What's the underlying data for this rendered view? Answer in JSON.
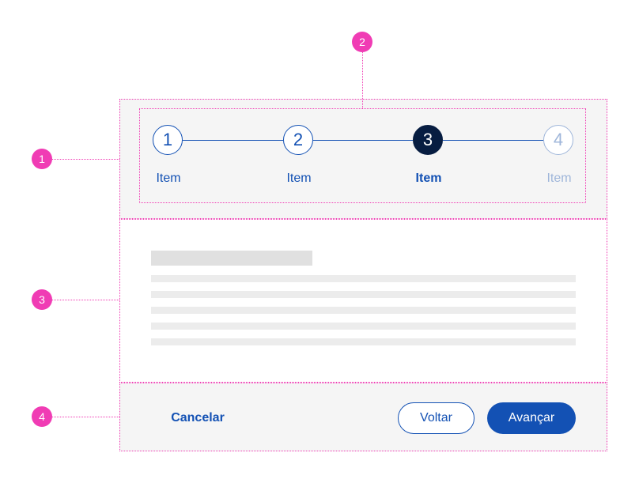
{
  "annotations": [
    "1",
    "2",
    "3",
    "4"
  ],
  "stepper": {
    "steps": [
      {
        "number": "1",
        "label": "Item",
        "state": "completed"
      },
      {
        "number": "2",
        "label": "Item",
        "state": "completed"
      },
      {
        "number": "3",
        "label": "Item",
        "state": "active"
      },
      {
        "number": "4",
        "label": "Item",
        "state": "disabled"
      }
    ]
  },
  "footer": {
    "cancel_label": "Cancelar",
    "back_label": "Voltar",
    "next_label": "Avançar"
  },
  "colors": {
    "primary": "#1351b4",
    "active": "#071d41",
    "disabled": "#9fb6da",
    "annotation": "#f03cb4",
    "section_bg": "#f5f5f5"
  }
}
